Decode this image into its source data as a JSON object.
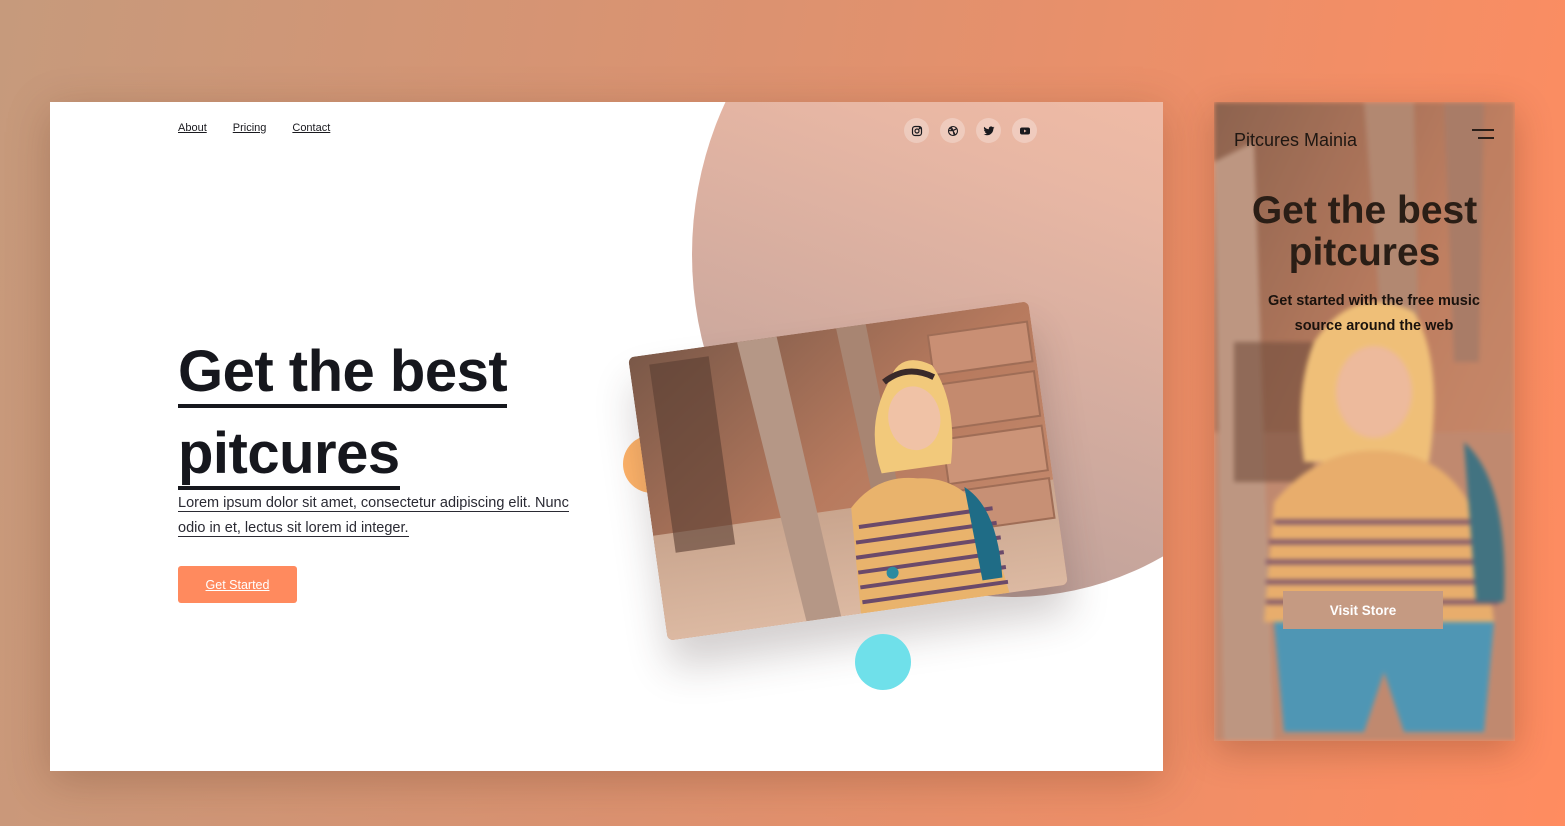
{
  "desktop": {
    "nav": [
      "About",
      "Pricing",
      "Contact"
    ],
    "social_icons": [
      "instagram-icon",
      "dribbble-icon",
      "twitter-icon",
      "youtube-icon"
    ],
    "hero": {
      "title_line1": "Get the best",
      "title_line2": "pitcures",
      "description": "Lorem ipsum dolor sit amet, consectetur adipiscing elit. Nunc odio in et, lectus sit lorem id integer.",
      "cta_label": "Get Started"
    }
  },
  "mobile": {
    "brand": "Pitcures Mainia",
    "menu_icon": "hamburger-menu-icon",
    "title_line1": "Get the best",
    "title_line2": "pitcures",
    "subtitle": "Get started with the free music source around the web",
    "cta_label": "Visit Store"
  },
  "colors": {
    "accent": "#ff8a5e",
    "text_dark": "#16171d",
    "dot_orange": "#ffb46a",
    "dot_cyan": "#6fe0ea",
    "mobile_button": "#c59a82"
  }
}
